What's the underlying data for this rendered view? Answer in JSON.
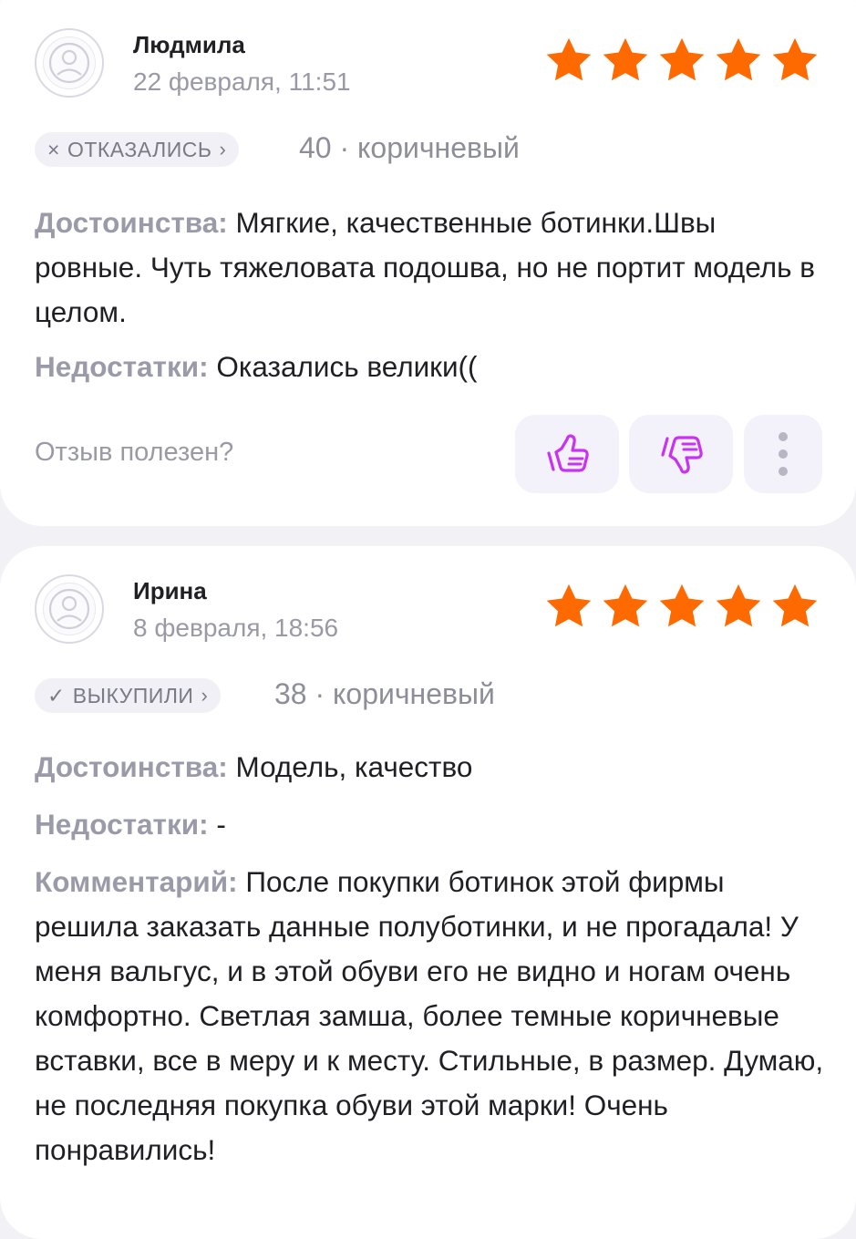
{
  "colors": {
    "star": "#ff6a00",
    "accent": "#c832f0",
    "label": "#9b9aa9",
    "muted": "#9a9aa6"
  },
  "reviews": [
    {
      "author": "Людмила",
      "date": "22 февраля, 11:51",
      "rating": 5,
      "status": {
        "icon": "×",
        "label": "ОТКАЗАЛИСЬ",
        "chevron": "›"
      },
      "variant": "40 · коричневый",
      "pros_label": "Достоинства:",
      "pros_text": " Мягкие, качественные ботинки.Швы ровные. Чуть тяжеловата подошва, но не портит модель в целом.",
      "cons_label": "Недостатки:",
      "cons_text": " Оказались велики((",
      "helpful_question": "Отзыв полезен?"
    },
    {
      "author": "Ирина",
      "date": "8 февраля, 18:56",
      "rating": 5,
      "status": {
        "icon": "✓",
        "label": "ВЫКУПИЛИ",
        "chevron": "›"
      },
      "variant": "38 · коричневый",
      "pros_label": "Достоинства:",
      "pros_text": " Модель, качество",
      "cons_label": "Недостатки:",
      "cons_text": " -",
      "comment_label": "Комментарий:",
      "comment_text": " После покупки ботинок этой фирмы решила заказать данные полуботинки, и не прогадала! У меня вальгус, и в этой обуви его не видно и ногам очень комфортно. Светлая замша, более темные коричневые вставки, все в меру и к месту. Стильные, в размер. Думаю, не последняя покупка  обуви этой марки! Очень понравились!"
    }
  ]
}
